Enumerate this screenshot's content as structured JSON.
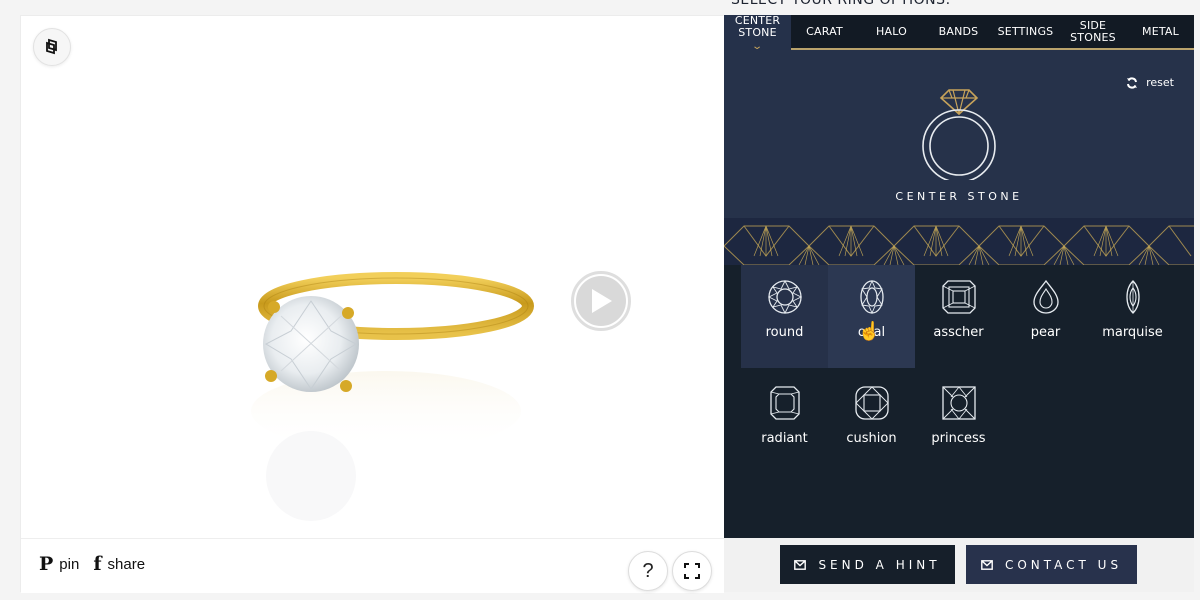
{
  "header": {
    "title": "SELECT YOUR RING OPTIONS:"
  },
  "viewer": {
    "logo_icon": "brand-cube-icon",
    "play_icon": "play-icon",
    "social": [
      {
        "icon": "pinterest-icon",
        "glyph": "P",
        "label": "pin"
      },
      {
        "icon": "facebook-icon",
        "glyph": "f",
        "label": "share"
      }
    ],
    "help_glyph": "?",
    "help_icon": "help-icon",
    "fullscreen_icon": "fullscreen-icon"
  },
  "tabs": [
    {
      "label": "CENTER STONE",
      "line1": "CENTER",
      "line2": "STONE",
      "active": true
    },
    {
      "label": "CARAT"
    },
    {
      "label": "HALO"
    },
    {
      "label": "BANDS"
    },
    {
      "label": "SETTINGS"
    },
    {
      "label": "SIDE STONES",
      "line1": "SIDE",
      "line2": "STONES"
    },
    {
      "label": "METAL"
    }
  ],
  "hero": {
    "reset_label": "reset",
    "title": "CENTER STONE"
  },
  "shapes": [
    {
      "label": "round",
      "selected": true
    },
    {
      "label": "oval",
      "hovered": true
    },
    {
      "label": "asscher"
    },
    {
      "label": "pear"
    },
    {
      "label": "marquise"
    },
    {
      "label": "radiant"
    },
    {
      "label": "cushion"
    },
    {
      "label": "princess"
    }
  ],
  "actions": {
    "send_hint": "SEND A HINT",
    "contact_us": "CONTACT US"
  },
  "colors": {
    "panel_dark": "#16202b",
    "panel_navy": "#26324a",
    "gold_accent": "#b9a36c",
    "ring_gold": "#d4a62a"
  }
}
